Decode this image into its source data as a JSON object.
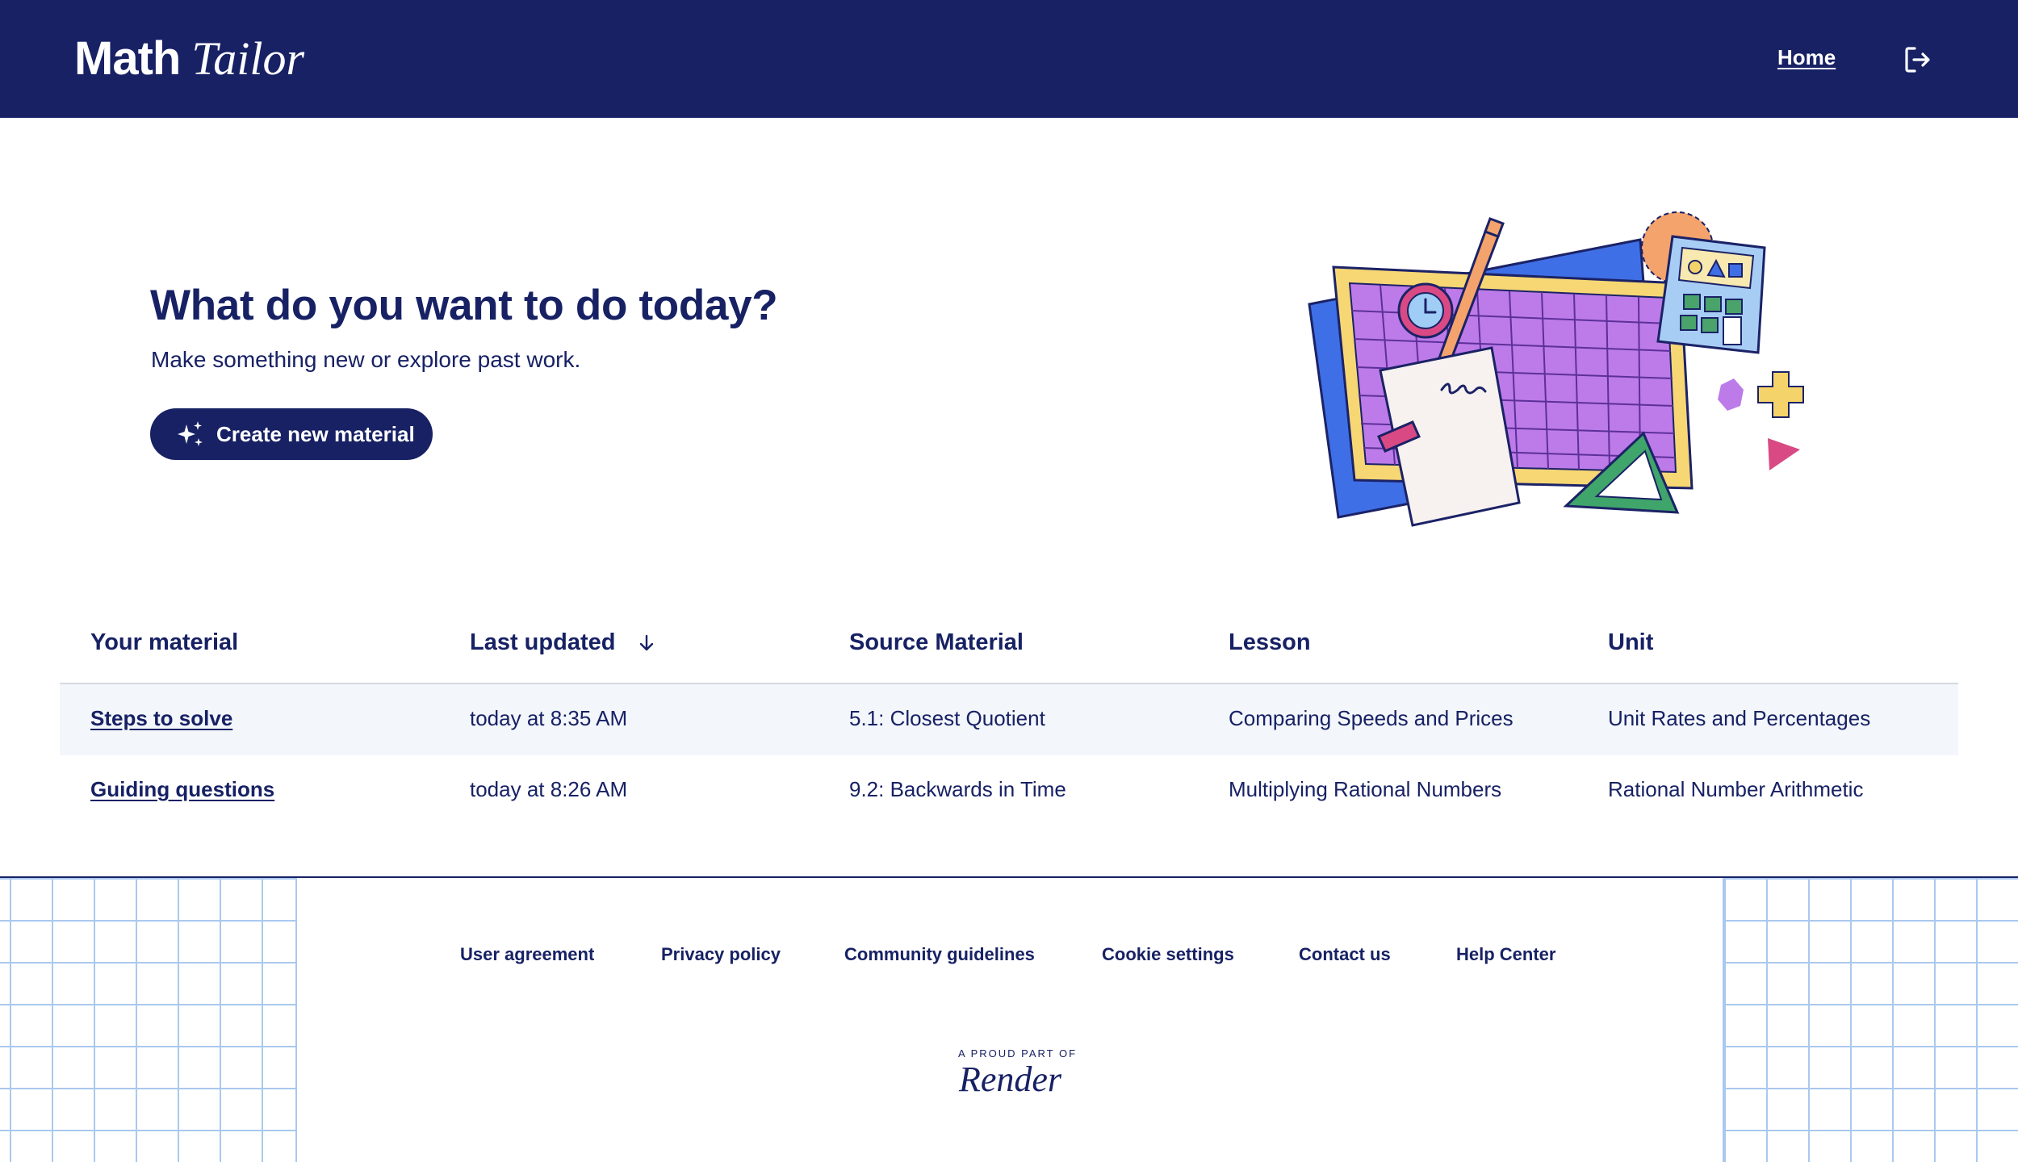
{
  "header": {
    "brand_part1": "Math",
    "brand_part2": "Tailor",
    "home_label": "Home",
    "logout_icon": "logout-icon",
    "background_color": "#172164"
  },
  "hero": {
    "title": "What do you want to do today?",
    "subtitle": "Make something new or explore past work.",
    "create_button_label": "Create new material",
    "create_button_icon": "sparkles-icon"
  },
  "table": {
    "columns": [
      "Your material",
      "Last updated",
      "Source Material",
      "Lesson",
      "Unit"
    ],
    "sort_column": "Last updated",
    "sort_icon": "arrow-down-icon",
    "rows": [
      {
        "material": "Steps to solve",
        "last_updated": "today at 8:35 AM",
        "source_material": "5.1: Closest Quotient",
        "lesson": "Comparing Speeds and Prices",
        "unit": "Unit Rates and Percentages"
      },
      {
        "material": "Guiding questions",
        "last_updated": "today at 8:26 AM",
        "source_material": "9.2: Backwards in Time",
        "lesson": "Multiplying Rational Numbers",
        "unit": "Rational Number Arithmetic"
      }
    ]
  },
  "footer": {
    "links": [
      "User agreement",
      "Privacy policy",
      "Community guidelines",
      "Cookie settings",
      "Contact us",
      "Help Center"
    ],
    "proud_text": "A PROUD PART OF",
    "render_logo": "Render"
  },
  "colors": {
    "navy": "#172164",
    "row_highlight": "#f3f6fb",
    "grid_blue": "#a9c9ee"
  }
}
